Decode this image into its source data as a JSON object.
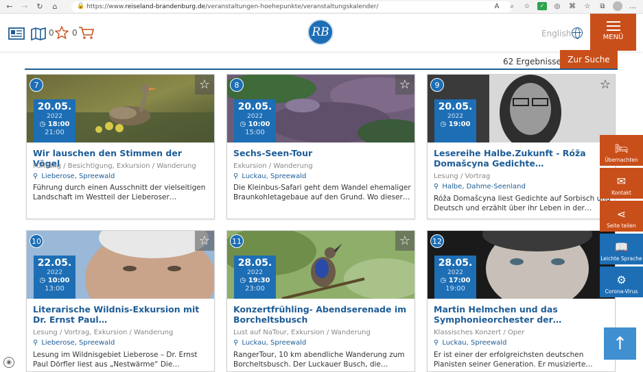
{
  "browser": {
    "url_prefix": "https://www.",
    "url_domain": "reiseland-brandenburg.de",
    "url_path": "/veranstaltungen-hoehepunkte/veranstaltungskalender/"
  },
  "header": {
    "favorites_count": "0",
    "cart_count": "0",
    "logo_text": "RB",
    "language": "English",
    "menu_label": "MENÜ"
  },
  "results": {
    "count": "62 Ergebnisse",
    "search_button": "Zur Suche"
  },
  "sidebar": [
    {
      "label": "Übernachten",
      "icon": "bed-icon",
      "color": "#c94f1a"
    },
    {
      "label": "Kontakt",
      "icon": "mail-icon",
      "color": "#c94f1a"
    },
    {
      "label": "Seite teilen",
      "icon": "share-icon",
      "color": "#c94f1a"
    },
    {
      "label": "Leichte Sprache",
      "icon": "book-reader-icon",
      "color": "#1d6eb5"
    },
    {
      "label": "Corona-Virus",
      "icon": "virus-icon",
      "color": "#1d6eb5"
    }
  ],
  "events": [
    {
      "num": "7",
      "date": "20.05.",
      "year": "2022",
      "start": "18:00",
      "end": "21:00",
      "title": "Wir lauschen den Stimmen der Vögel",
      "category": "Führung / Besichtigung, Exkursion / Wanderung",
      "location": "Lieberose, Spreewald",
      "description": "Führung durch einen Ausschnitt der vielseitigen Landschaft im Westteil der Lieberoser…"
    },
    {
      "num": "8",
      "date": "20.05.",
      "year": "2022",
      "start": "10:00",
      "end": "15:00",
      "title": "Sechs-Seen-Tour",
      "category": "Exkursion / Wanderung",
      "location": "Luckau, Spreewald",
      "description": "Die Kleinbus-Safari geht dem Wandel ehemaliger Braunkohletagebaue auf den Grund. Wo dieser…"
    },
    {
      "num": "9",
      "date": "20.05.",
      "year": "2022",
      "start": "19:00",
      "end": "",
      "title": "Lesereihe Halbe.Zukunft - Róža Domašcyna Gedichte…",
      "category": "Lesung / Vortrag",
      "location": "Halbe, Dahme-Seenland",
      "description": "Róža Domašcyna liest Gedichte auf Sorbisch und Deutsch und erzählt über ihr Leben in der…"
    },
    {
      "num": "10",
      "date": "22.05.",
      "year": "2022",
      "start": "10:00",
      "end": "13:00",
      "title": "Literarische Wildnis-Exkursion mit Dr. Ernst Paul…",
      "category": "Lesung / Vortrag, Exkursion / Wanderung",
      "location": "Lieberose, Spreewald",
      "description": "Lesung im Wildnisgebiet Lieberose – Dr. Ernst Paul Dörfler liest aus „Nestwärme“ Die…"
    },
    {
      "num": "11",
      "date": "28.05.",
      "year": "2022",
      "start": "19:30",
      "end": "23:00",
      "title": "Konzertfrühling- Abendserenade im Borcheltsbusch",
      "category": "Lust auf NaTour, Exkursion / Wanderung",
      "location": "Luckau, Spreewald",
      "description": "RangerTour, 10 km abendliche Wanderung zum Borcheltsbusch. Der Luckauer Busch, die…"
    },
    {
      "num": "12",
      "date": "28.05.",
      "year": "2022",
      "start": "17:00",
      "end": "19:00",
      "title": "Martin Helmchen und das Symphonieorchester der…",
      "category": "Klassisches Konzert / Oper",
      "location": "Luckau, Spreewald",
      "description": "Er ist einer der erfolgreichsten deutschen Pianisten seiner Generation. Er musizierte…"
    }
  ]
}
